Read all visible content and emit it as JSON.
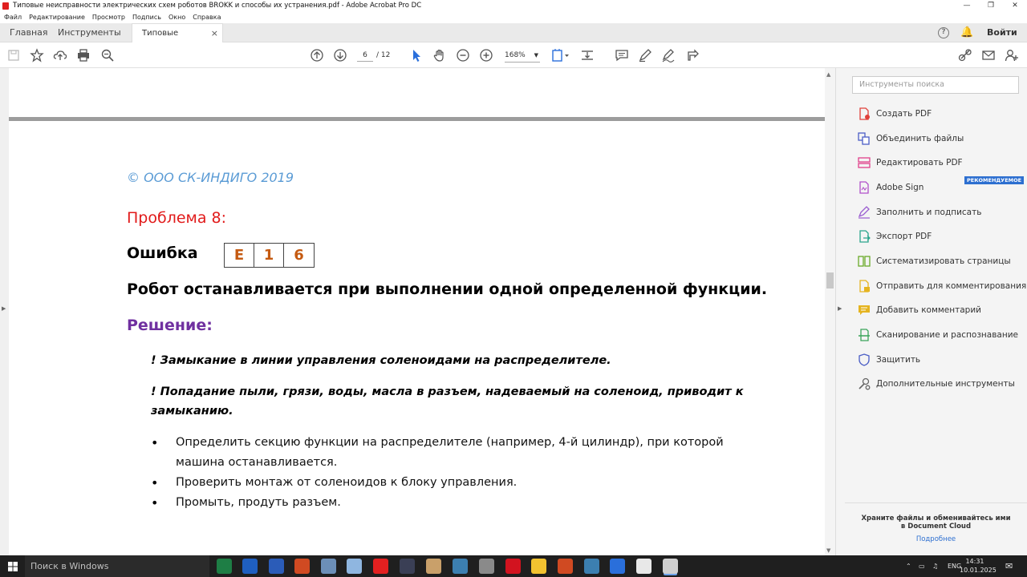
{
  "window": {
    "title": "Типовые неисправности электрических схем роботов BROKK и способы их устранения.pdf - Adobe Acrobat Pro DC",
    "controls": [
      "minimize",
      "restore",
      "close"
    ]
  },
  "menu": [
    "Файл",
    "Редактирование",
    "Просмотр",
    "Подпись",
    "Окно",
    "Справка"
  ],
  "tabs": {
    "home": "Главная",
    "tools": "Инструменты",
    "document": "Типовые неисправ...",
    "close": "×"
  },
  "header_right": {
    "help": "?",
    "signin": "Войти"
  },
  "toolbar": {
    "page_current": "6",
    "page_total": "/ 12",
    "zoom": "168%"
  },
  "document": {
    "copyright": "© ООО СК-ИНДИГО 2019",
    "problem": "Проблема 8:",
    "error_label": "Ошибка",
    "error_code": [
      "E",
      "1",
      "6"
    ],
    "heading": "Робот останавливается при выполнении одной определенной функции.",
    "solution": "Решение:",
    "notes": [
      "! Замыкание в линии управления соленоидами на распределителе.",
      "! Попадание пыли, грязи, воды, масла в разъем, надеваемый на соленоид, приводит к замыканию."
    ],
    "bullets": [
      "Определить секцию функции на распределителе (например, 4-й цилиндр), при которой машина останавливается.",
      "Проверить монтаж от соленоидов к блоку управления.",
      "Промыть, продуть разъем."
    ]
  },
  "tools_pane": {
    "search_placeholder": "Инструменты поиска",
    "recommended_badge": "РЕКОМЕНДУЕМОЕ",
    "items": [
      {
        "label": "Создать PDF",
        "icon": "create-pdf-icon",
        "color": "#e0403a"
      },
      {
        "label": "Объединить файлы",
        "icon": "combine-files-icon",
        "color": "#4b5ec6"
      },
      {
        "label": "Редактировать PDF",
        "icon": "edit-pdf-icon",
        "color": "#e0408a"
      },
      {
        "label": "Adobe Sign",
        "icon": "adobe-sign-icon",
        "color": "#b04fc9"
      },
      {
        "label": "Заполнить и подписать",
        "icon": "fill-sign-icon",
        "color": "#9a5cd0"
      },
      {
        "label": "Экспорт PDF",
        "icon": "export-pdf-icon",
        "color": "#2aa58c"
      },
      {
        "label": "Систематизировать страницы",
        "icon": "organize-pages-icon",
        "color": "#6aaa2a"
      },
      {
        "label": "Отправить для комментирования",
        "icon": "send-comment-icon",
        "color": "#e5b420"
      },
      {
        "label": "Добавить комментарий",
        "icon": "comment-icon",
        "color": "#e5b420"
      },
      {
        "label": "Сканирование и распознавание",
        "icon": "scan-icon",
        "color": "#3aa55a"
      },
      {
        "label": "Защитить",
        "icon": "protect-icon",
        "color": "#4b5ec6"
      },
      {
        "label": "Дополнительные инструменты",
        "icon": "more-tools-icon",
        "color": "#666666"
      }
    ],
    "promo_text": "Храните файлы и обменивайтесь ими в Document Cloud",
    "promo_link": "Подробнее"
  },
  "taskbar": {
    "search_placeholder": "Поиск в Windows",
    "language": "ENG",
    "time": "14:31",
    "date": "10.01.2025",
    "apps": [
      {
        "name": "excel-app",
        "color": "#1e7e45"
      },
      {
        "name": "outlook-app",
        "color": "#1f5fc0"
      },
      {
        "name": "word-app",
        "color": "#2b5cb8"
      },
      {
        "name": "powerpoint-app",
        "color": "#d04a22"
      },
      {
        "name": "computer-app",
        "color": "#6c8fb8"
      },
      {
        "name": "notepad-app",
        "color": "#8fb6e0"
      },
      {
        "name": "yandex-app",
        "color": "#e32020"
      },
      {
        "name": "camera-app",
        "color": "#3a3f55"
      },
      {
        "name": "paint-app",
        "color": "#c9a06a"
      },
      {
        "name": "map-app",
        "color": "#3c7fb0"
      },
      {
        "name": "settings-app",
        "color": "#8a8a8a"
      },
      {
        "name": "opera-app",
        "color": "#d2131f"
      },
      {
        "name": "explorer-app",
        "color": "#f2c230"
      },
      {
        "name": "tool-app",
        "color": "#d04a22"
      },
      {
        "name": "monitor-app",
        "color": "#3c7fb0"
      },
      {
        "name": "chrome-app",
        "color": "#2a6fdb"
      },
      {
        "name": "yandex-browser-app",
        "color": "#e8e8e8"
      },
      {
        "name": "acrobat-app",
        "color": "#cfcfcf"
      }
    ]
  }
}
